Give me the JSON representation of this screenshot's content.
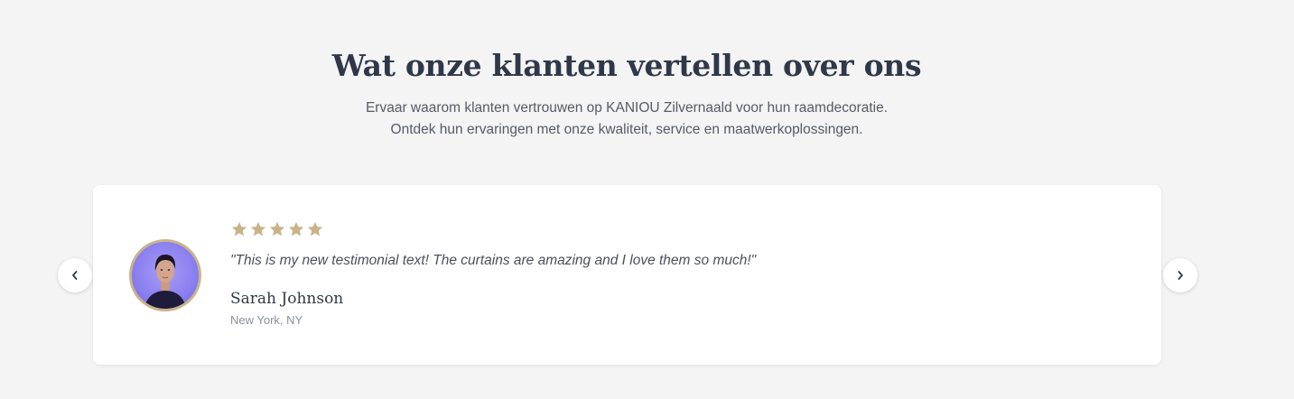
{
  "header": {
    "title": "Wat onze klanten vertellen over ons",
    "subtitle_line1": "Ervaar waarom klanten vertrouwen op KANIOU Zilvernaald voor hun raamdecoratie.",
    "subtitle_line2": "Ontdek hun ervaringen met onze kwaliteit, service en maatwerkoplossingen."
  },
  "testimonial": {
    "rating": 5,
    "rating_max": 5,
    "quote": "\"This is my new testimonial text! The curtains are amazing and I love them so much!\"",
    "author_name": "Sarah Johnson",
    "author_location": "New York, NY",
    "avatar_icon": "customer-avatar"
  },
  "navigation": {
    "prev_icon": "chevron-left-icon",
    "next_icon": "chevron-right-icon"
  },
  "colors": {
    "background": "#f4f4f4",
    "heading": "#2f3849",
    "star": "#c9b48a",
    "avatar_border": "#c9b48a",
    "card": "#ffffff"
  }
}
